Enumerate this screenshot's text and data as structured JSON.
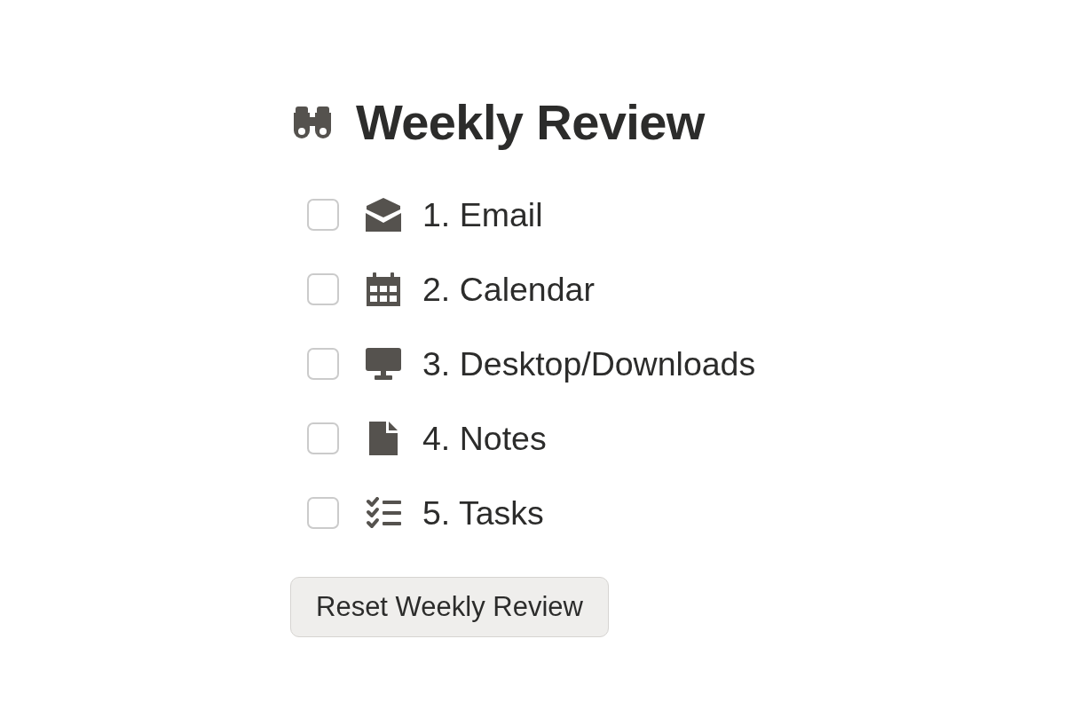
{
  "title": "Weekly Review",
  "items": [
    {
      "label": "1. Email",
      "checked": false
    },
    {
      "label": "2. Calendar",
      "checked": false
    },
    {
      "label": "3. Desktop/Downloads",
      "checked": false
    },
    {
      "label": "4. Notes",
      "checked": false
    },
    {
      "label": "5. Tasks",
      "checked": false
    }
  ],
  "reset_button": {
    "label": "Reset Weekly Review"
  }
}
